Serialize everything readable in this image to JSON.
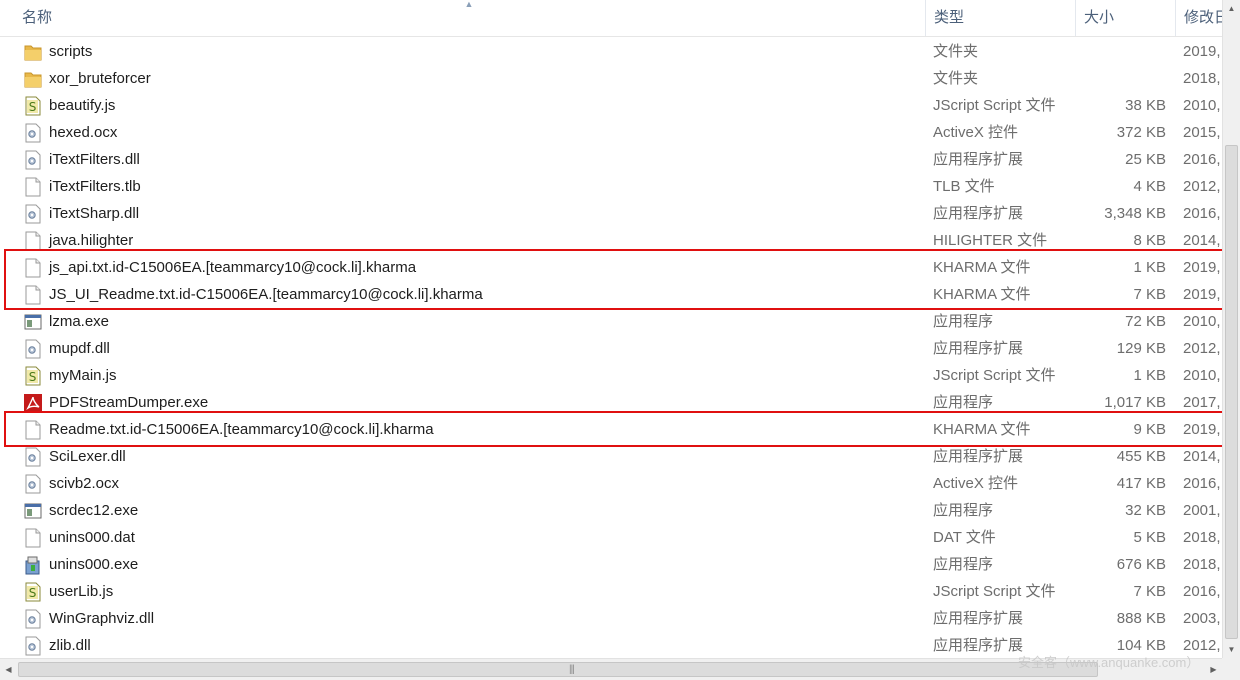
{
  "columns": {
    "name": "名称",
    "type": "类型",
    "size": "大小",
    "date": "修改日"
  },
  "sort_indicator": "▲",
  "files": [
    {
      "name": "scripts",
      "type": "文件夹",
      "size": "",
      "date": "2019,",
      "icon": "folder-icon"
    },
    {
      "name": "xor_bruteforcer",
      "type": "文件夹",
      "size": "",
      "date": "2018,",
      "icon": "folder-icon"
    },
    {
      "name": "beautify.js",
      "type": "JScript Script 文件",
      "size": "38 KB",
      "date": "2010,",
      "icon": "jscript-file-icon"
    },
    {
      "name": "hexed.ocx",
      "type": "ActiveX 控件",
      "size": "372 KB",
      "date": "2015,",
      "icon": "dll-file-icon"
    },
    {
      "name": "iTextFilters.dll",
      "type": "应用程序扩展",
      "size": "25 KB",
      "date": "2016,",
      "icon": "dll-file-icon"
    },
    {
      "name": "iTextFilters.tlb",
      "type": "TLB 文件",
      "size": "4 KB",
      "date": "2012,",
      "icon": "blank-file-icon"
    },
    {
      "name": "iTextSharp.dll",
      "type": "应用程序扩展",
      "size": "3,348 KB",
      "date": "2016,",
      "icon": "dll-file-icon"
    },
    {
      "name": "java.hilighter",
      "type": "HILIGHTER 文件",
      "size": "8 KB",
      "date": "2014,",
      "icon": "blank-file-icon"
    },
    {
      "name": "js_api.txt.id-C15006EA.[teammarcy10@cock.li].kharma",
      "type": "KHARMA 文件",
      "size": "1 KB",
      "date": "2019,",
      "icon": "blank-file-icon"
    },
    {
      "name": "JS_UI_Readme.txt.id-C15006EA.[teammarcy10@cock.li].kharma",
      "type": "KHARMA 文件",
      "size": "7 KB",
      "date": "2019,",
      "icon": "blank-file-icon"
    },
    {
      "name": "lzma.exe",
      "type": "应用程序",
      "size": "72 KB",
      "date": "2010,",
      "icon": "exe-file-icon"
    },
    {
      "name": "mupdf.dll",
      "type": "应用程序扩展",
      "size": "129 KB",
      "date": "2012,",
      "icon": "dll-file-icon"
    },
    {
      "name": "myMain.js",
      "type": "JScript Script 文件",
      "size": "1 KB",
      "date": "2010,",
      "icon": "jscript-file-icon"
    },
    {
      "name": "PDFStreamDumper.exe",
      "type": "应用程序",
      "size": "1,017 KB",
      "date": "2017,",
      "icon": "pdf-app-icon"
    },
    {
      "name": "Readme.txt.id-C15006EA.[teammarcy10@cock.li].kharma",
      "type": "KHARMA 文件",
      "size": "9 KB",
      "date": "2019,",
      "icon": "blank-file-icon"
    },
    {
      "name": "SciLexer.dll",
      "type": "应用程序扩展",
      "size": "455 KB",
      "date": "2014,",
      "icon": "dll-file-icon"
    },
    {
      "name": "scivb2.ocx",
      "type": "ActiveX 控件",
      "size": "417 KB",
      "date": "2016,",
      "icon": "dll-file-icon"
    },
    {
      "name": "scrdec12.exe",
      "type": "应用程序",
      "size": "32 KB",
      "date": "2001,",
      "icon": "exe-file-icon"
    },
    {
      "name": "unins000.dat",
      "type": "DAT 文件",
      "size": "5 KB",
      "date": "2018,",
      "icon": "blank-file-icon"
    },
    {
      "name": "unins000.exe",
      "type": "应用程序",
      "size": "676 KB",
      "date": "2018,",
      "icon": "installer-icon"
    },
    {
      "name": "userLib.js",
      "type": "JScript Script 文件",
      "size": "7 KB",
      "date": "2016,",
      "icon": "jscript-file-icon"
    },
    {
      "name": "WinGraphviz.dll",
      "type": "应用程序扩展",
      "size": "888 KB",
      "date": "2003,",
      "icon": "dll-file-icon"
    },
    {
      "name": "zlib.dll",
      "type": "应用程序扩展",
      "size": "104 KB",
      "date": "2012,",
      "icon": "dll-file-icon"
    }
  ],
  "highlighted_files": [
    "js_api.txt.id-C15006EA.[teammarcy10@cock.li].kharma",
    "JS_UI_Readme.txt.id-C15006EA.[teammarcy10@cock.li].kharma",
    "Readme.txt.id-C15006EA.[teammarcy10@cock.li].kharma"
  ],
  "highlight_color": "#e01010",
  "scrollbar": {
    "grip": "|||",
    "up": "▲",
    "down": "▼",
    "left": "◀",
    "right": "▶"
  },
  "watermark": "安全客（www.anquanke.com）"
}
